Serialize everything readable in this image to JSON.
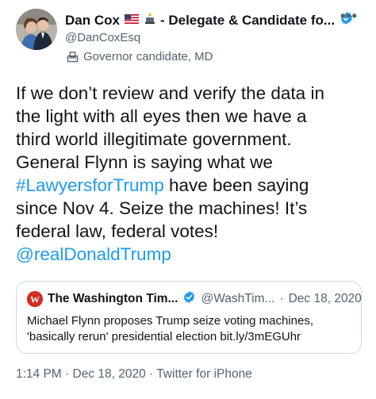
{
  "author": {
    "name": "Dan Cox",
    "title_suffix": "- Delegate & Candidate fo...",
    "handle": "@DanCoxEsq",
    "label": "Governor candidate, MD",
    "icons": [
      "us-flag-icon",
      "candle-icon",
      "verified-badge-icon",
      "ballot-box-icon",
      "more-icon"
    ],
    "verified_color": "#1d9bf0"
  },
  "tweet": {
    "line1": "If we don’t review and verify the data in",
    "line2": "the light with all eyes then we have a",
    "line3": "third world illegitimate government.",
    "line4": "General Flynn is saying what we",
    "hashtag": "#LawyersforTrump",
    "line5_rest": " have been saying",
    "line6": "since Nov 4. Seize the machines! It’s",
    "line7": "federal law, federal votes!",
    "mention": "@realDonaldTrump",
    "link_color": "#1d9bf0"
  },
  "quote": {
    "name": "The Washington Tim...",
    "handle": "@WashTim...",
    "separator": "·",
    "date": "Dec 18, 2020",
    "line1": "Michael Flynn proposes Trump seize voting machines,",
    "line2_text": "'basically rerun' presidential election",
    "line2_link": "bit.ly/3mEGUhr",
    "logo_color": "#d12d21"
  },
  "footer": {
    "text": "1:14 PM · Dec 18, 2020 · Twitter for iPhone"
  }
}
